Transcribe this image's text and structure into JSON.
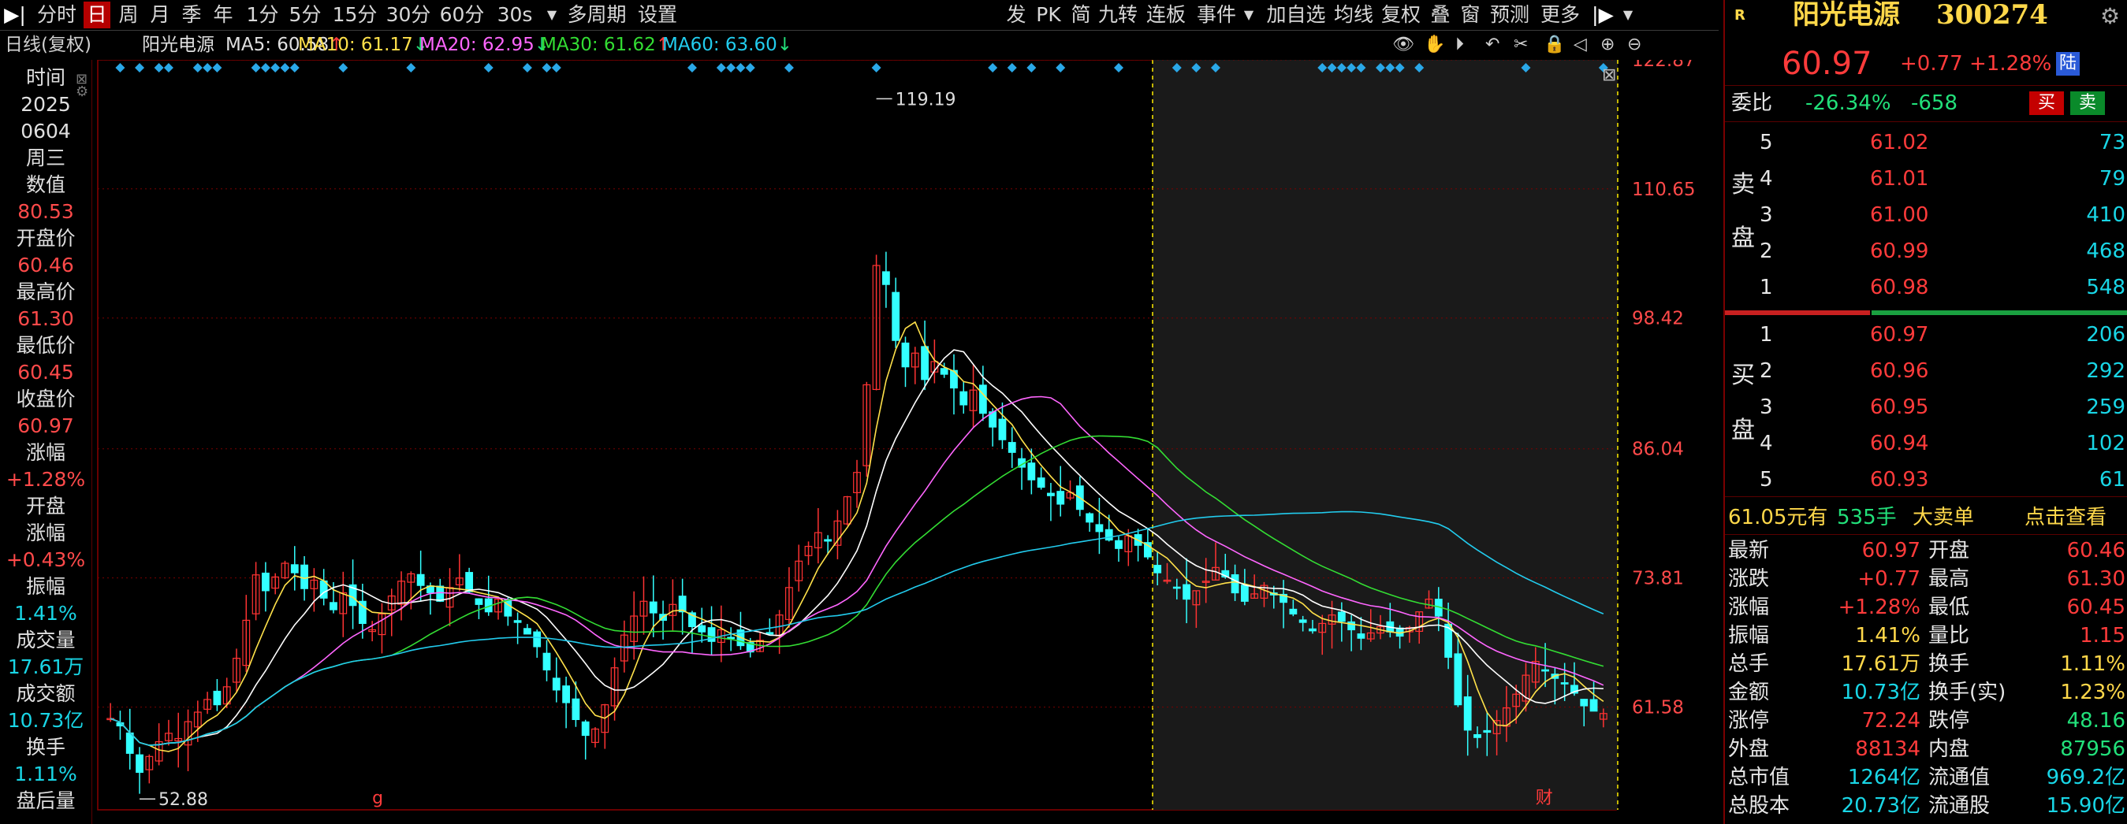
{
  "toolbar": {
    "items": [
      "分时",
      "日",
      "周",
      "月",
      "季",
      "年",
      "1分",
      "5分",
      "15分",
      "30分",
      "60分",
      "30s",
      "多周期",
      "设置"
    ],
    "right_items": [
      "发",
      "PK",
      "简",
      "九转",
      "连板",
      "事件",
      "加自选",
      "均线",
      "复权",
      "叠",
      "窗",
      "预测",
      "更多"
    ]
  },
  "infobar": {
    "period": "日线(复权)",
    "stock": "阳光电源",
    "ma5": "MA5: 60.58",
    "ma10": "MA10: 61.17",
    "ma20": "MA20: 62.95",
    "ma30": "MA30: 61.62",
    "ma60": "MA60: 63.60",
    "ma5_arrow": "↑",
    "ma10_arrow": "↓",
    "ma20_arrow": "↓",
    "ma30_arrow": "↑",
    "ma60_arrow": "↓"
  },
  "left_panel": {
    "time_label": "时间",
    "year": "2025",
    "date": "0604",
    "weekday": "周三",
    "value_label": "数值",
    "value": "80.53",
    "open_label": "开盘价",
    "open": "60.46",
    "high_label": "最高价",
    "high": "61.30",
    "low_label": "最低价",
    "low": "60.45",
    "close_label": "收盘价",
    "close": "60.97",
    "change_label": "涨幅",
    "change": "+1.28%",
    "open_change_label_1": "开盘",
    "open_change_label_2": "涨幅",
    "open_change": "+0.43%",
    "amplitude_label": "振幅",
    "amplitude": "1.41%",
    "volume_label": "成交量",
    "volume": "17.61万",
    "turnover_amt_label": "成交额",
    "turnover_amt": "10.73亿",
    "turnover_label": "换手",
    "turnover": "1.11%",
    "after_hours_label": "盘后量"
  },
  "chart_data": {
    "type": "candlestick",
    "y_ticks": [
      "122.87",
      "110.65",
      "98.42",
      "86.04",
      "73.81",
      "61.58"
    ],
    "ylim": [
      52.0,
      122.87
    ],
    "annotations": {
      "high": "119.19",
      "low": "52.88"
    },
    "markers": [
      "g",
      "财"
    ],
    "close": [
      60.5,
      59.8,
      57.2,
      55.4,
      56.9,
      58.3,
      59.1,
      58.6,
      60.2,
      61.1,
      62.3,
      61.8,
      63.5,
      66.2,
      69.8,
      74.1,
      72.6,
      73.9,
      75.2,
      74.3,
      72.8,
      73.6,
      71.9,
      70.8,
      72.4,
      71.2,
      69.5,
      68.9,
      70.4,
      72.1,
      73.5,
      74.2,
      73.1,
      72.4,
      71.6,
      72.9,
      73.8,
      72.5,
      71.3,
      70.6,
      71.8,
      70.2,
      69.6,
      68.5,
      67.3,
      65.1,
      63.2,
      62.0,
      60.4,
      58.9,
      59.5,
      61.8,
      65.3,
      68.4,
      70.2,
      71.6,
      70.5,
      69.8,
      71.3,
      70.6,
      69.2,
      68.7,
      67.8,
      68.9,
      68.1,
      67.4,
      66.8,
      67.9,
      68.5,
      70.3,
      72.9,
      75.4,
      76.8,
      78.1,
      77.3,
      79.2,
      81.5,
      83.8,
      92.1,
      103.4,
      101.6,
      96.3,
      93.8,
      95.1,
      92.6,
      94.3,
      93.1,
      91.8,
      90.2,
      91.6,
      89.4,
      88.1,
      86.9,
      85.7,
      84.3,
      83.1,
      82.4,
      81.6,
      80.8,
      81.9,
      80.3,
      79.1,
      78.2,
      77.4,
      76.6,
      77.8,
      76.9,
      75.8,
      74.3,
      73.6,
      72.9,
      71.8,
      72.6,
      73.5,
      74.8,
      73.9,
      72.4,
      71.6,
      72.3,
      73.1,
      72.2,
      71.5,
      70.4,
      69.6,
      68.8,
      69.5,
      70.3,
      69.7,
      68.9,
      68.1,
      68.6,
      69.2,
      68.7,
      68.3,
      69.1,
      70.6,
      71.8,
      70.2,
      66.3,
      61.8,
      59.4,
      58.7,
      59.2,
      60.3,
      61.5,
      62.8,
      64.6,
      65.9,
      65.1,
      64.3,
      63.8,
      62.9,
      61.7,
      61.2,
      60.97
    ],
    "series": [
      {
        "name": "MA5",
        "color": "#ffe14a"
      },
      {
        "name": "MA10",
        "color": "#ffe14a"
      },
      {
        "name": "MA20",
        "color": "#ff66ff"
      },
      {
        "name": "MA30",
        "color": "#33dd33"
      },
      {
        "name": "MA60",
        "color": "#22ccee"
      }
    ]
  },
  "right_panel": {
    "logo": "R",
    "name": "阳光电源",
    "code": "300274",
    "price": "60.97",
    "change": "+0.77",
    "change_pct": "+1.28%",
    "tag": "陆",
    "weibi_label": "委比",
    "weibi": "-26.34%",
    "weicha": "-658",
    "buy_btn": "买",
    "sell_btn": "卖",
    "sell_side_label": [
      "卖",
      "盘"
    ],
    "buy_side_label": [
      "买",
      "盘"
    ],
    "sell_orders": [
      {
        "level": "5",
        "price": "61.02",
        "vol": "73"
      },
      {
        "level": "4",
        "price": "61.01",
        "vol": "79"
      },
      {
        "level": "3",
        "price": "61.00",
        "vol": "410"
      },
      {
        "level": "2",
        "price": "60.99",
        "vol": "468"
      },
      {
        "level": "1",
        "price": "60.98",
        "vol": "548"
      }
    ],
    "buy_orders": [
      {
        "level": "1",
        "price": "60.97",
        "vol": "206"
      },
      {
        "level": "2",
        "price": "60.96",
        "vol": "292"
      },
      {
        "level": "3",
        "price": "60.95",
        "vol": "259"
      },
      {
        "level": "4",
        "price": "60.94",
        "vol": "102"
      },
      {
        "level": "5",
        "price": "60.93",
        "vol": "61"
      }
    ],
    "big_order_price": "61.05元有",
    "big_order_vol": "535手",
    "big_order_label": "大卖单",
    "big_order_link": "点击查看",
    "stats": [
      {
        "l1": "最新",
        "v1": "60.97",
        "c1": "red",
        "l2": "开盘",
        "v2": "60.46",
        "c2": "red"
      },
      {
        "l1": "涨跌",
        "v1": "+0.77",
        "c1": "red",
        "l2": "最高",
        "v2": "61.30",
        "c2": "red"
      },
      {
        "l1": "涨幅",
        "v1": "+1.28%",
        "c1": "red",
        "l2": "最低",
        "v2": "60.45",
        "c2": "red"
      },
      {
        "l1": "振幅",
        "v1": "1.41%",
        "c1": "yellow",
        "l2": "量比",
        "v2": "1.15",
        "c2": "red"
      },
      {
        "l1": "总手",
        "v1": "17.61万",
        "c1": "yellow",
        "l2": "换手",
        "v2": "1.11%",
        "c2": "yellow"
      },
      {
        "l1": "金额",
        "v1": "10.73亿",
        "c1": "cyan",
        "l2": "换手(实)",
        "v2": "1.23%",
        "c2": "yellow"
      },
      {
        "l1": "涨停",
        "v1": "72.24",
        "c1": "red",
        "l2": "跌停",
        "v2": "48.16",
        "c2": "green"
      },
      {
        "l1": "外盘",
        "v1": "88134",
        "c1": "red",
        "l2": "内盘",
        "v2": "87956",
        "c2": "green"
      },
      {
        "l1": "总市值",
        "v1": "1264亿",
        "c1": "cyan",
        "l2": "流通值",
        "v2": "969.2亿",
        "c2": "cyan"
      },
      {
        "l1": "总股本",
        "v1": "20.73亿",
        "c1": "cyan",
        "l2": "流通股",
        "v2": "15.90亿",
        "c2": "cyan"
      }
    ]
  }
}
